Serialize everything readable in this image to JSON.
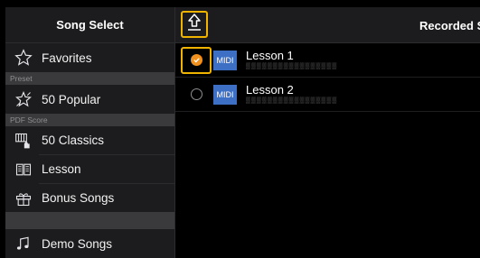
{
  "sidebar": {
    "title": "Song Select",
    "items": [
      {
        "label": "Favorites",
        "icon": "star-icon"
      },
      {
        "section": "Preset"
      },
      {
        "label": "50 Popular",
        "icon": "star-burst-icon"
      },
      {
        "section": "PDF Score"
      },
      {
        "label": "50 Classics",
        "icon": "piano-hands-icon"
      },
      {
        "label": "Lesson",
        "icon": "book-icon"
      },
      {
        "label": "Bonus Songs",
        "icon": "gift-icon"
      },
      {
        "label": "Demo Songs",
        "icon": "music-notes-icon"
      }
    ]
  },
  "main": {
    "title": "Recorded S",
    "upload_icon": "upload-arrow-icon",
    "rows": [
      {
        "badge": "MIDI",
        "title": "Lesson 1",
        "subtitle": "▒▒▒▒▒▒▒▒▒▒▒▒▒▒▒▒▒",
        "selected": true
      },
      {
        "badge": "MIDI",
        "title": "Lesson 2",
        "subtitle": "▒▒▒▒▒▒▒▒▒▒▒▒▒▒▒▒▒",
        "selected": false
      }
    ]
  },
  "colors": {
    "accent": "#f0b400",
    "check": "#f0901e",
    "midi": "#3d6fc4"
  }
}
